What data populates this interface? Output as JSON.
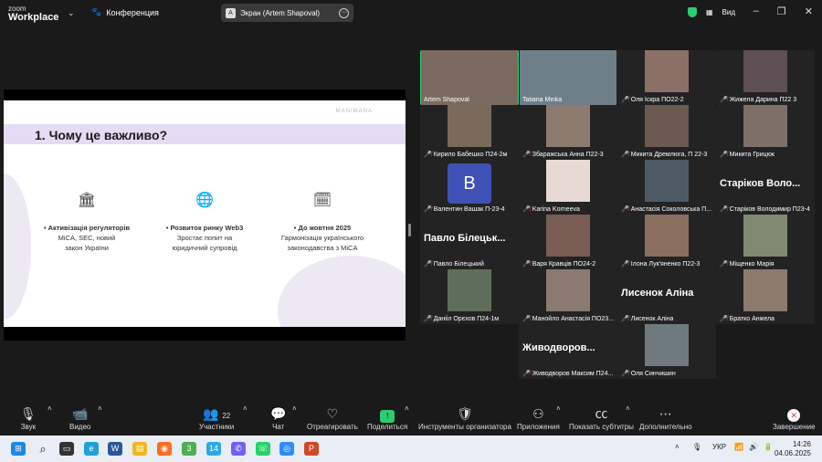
{
  "app": {
    "brand_top": "zoom",
    "brand_bottom": "Workplace",
    "meeting_label": "Конференция"
  },
  "share_pill": {
    "avatar_letter": "A",
    "label": "Экран (Artem Shapoval)"
  },
  "view": {
    "label": "Вид"
  },
  "slide": {
    "brand": "MANIMANA",
    "title": "1. Чому це важливо?",
    "points": [
      {
        "icon": "bank-icon",
        "head": "Активізація регуляторів",
        "body": [
          "MiCA, SEC, новий",
          "закон України"
        ]
      },
      {
        "icon": "globe-icon",
        "head": "Розвиток ринку Web3",
        "body": [
          "Зростає попит на",
          "юридичний супровід"
        ]
      },
      {
        "icon": "calendar-icon",
        "head": "До жовтня 2025",
        "body": [
          "Гармонізація українського",
          "законодавства з MiCA"
        ]
      }
    ]
  },
  "participants": [
    {
      "name": "Artem Shapoval",
      "video": true,
      "active": true,
      "muted": false
    },
    {
      "name": "Tatiana Minka",
      "video": true,
      "muted": false
    },
    {
      "name": "Оля Іскра ПО22-2",
      "video": true,
      "muted": true
    },
    {
      "name": "Жижела Дарина П22 3",
      "video": true,
      "muted": true
    },
    {
      "name": "Кирило Бабешко П24-2м",
      "video": true,
      "muted": true
    },
    {
      "name": "Збаражська Анна П22-3",
      "video": true,
      "muted": true
    },
    {
      "name": "Микита Дремлюга, П 22-3",
      "video": true,
      "muted": true
    },
    {
      "name": "Микита Грицюк",
      "video": true,
      "muted": true
    },
    {
      "name": "Валентин Вашак П-23-4",
      "video": false,
      "avatar": "B",
      "muted": true
    },
    {
      "name": "Karina Korneeva",
      "video": true,
      "muted": true
    },
    {
      "name": "Анастасія Соколовська П...",
      "video": true,
      "muted": true
    },
    {
      "name": "Старіков Володимир П23-4",
      "video": false,
      "big": "Старіков Воло...",
      "muted": true
    },
    {
      "name": "Павло Білецький",
      "video": false,
      "big": "Павло Білецьк...",
      "muted": true
    },
    {
      "name": "Варя Кравців ПО24-2",
      "video": true,
      "muted": true
    },
    {
      "name": "Ілона Лук'яненко П22-3",
      "video": true,
      "muted": true
    },
    {
      "name": "Міщенко Марія",
      "video": true,
      "muted": true
    },
    {
      "name": "Данііл Орєхов П24-1м",
      "video": true,
      "muted": true
    },
    {
      "name": "Манойло Анастасія ПО23...",
      "video": true,
      "muted": true
    },
    {
      "name": "Лисенок Аліна",
      "video": false,
      "big": "Лисенок Аліна",
      "muted": true
    },
    {
      "name": "Братко Анжела",
      "video": true,
      "muted": true
    },
    {
      "name": "Живодворов Максим П24...",
      "video": false,
      "big": "Живодворов...",
      "muted": true
    },
    {
      "name": "Оля Синчишин",
      "video": true,
      "muted": true
    }
  ],
  "toolbar": {
    "audio": "Звук",
    "video": "Видео",
    "participants": "Участники",
    "participants_count": "22",
    "chat": "Чат",
    "react": "Отреагировать",
    "share": "Поделиться",
    "host_tools": "Инструменты организатора",
    "apps": "Приложения",
    "captions": "Показать субтитры",
    "more": "Дополнительно",
    "end": "Завершение"
  },
  "taskbar": {
    "lang": "УКР",
    "time": "14:26",
    "date": "04.06.2025",
    "badge_chrome": "3",
    "badge_telegram": "14"
  }
}
